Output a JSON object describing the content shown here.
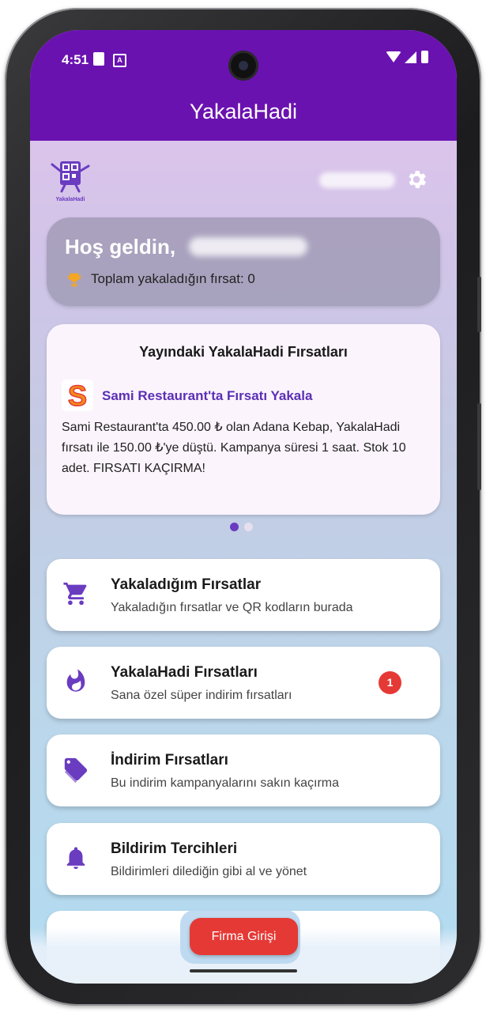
{
  "status_bar": {
    "time": "4:51",
    "keyboard_indicator": "A"
  },
  "app_bar": {
    "title": "YakalaHadi"
  },
  "header": {
    "logo_text": "YakalaHadi",
    "settings_icon": "gear-icon"
  },
  "welcome": {
    "greeting": "Hoş geldin,",
    "total_label": "Toplam yakaladığın fırsat: 0"
  },
  "promo": {
    "heading": "Yayındaki YakalaHadi Fırsatları",
    "title": "Sami Restaurant'ta Fırsatı Yakala",
    "body": "Sami Restaurant'ta 450.00 ₺ olan Adana Kebap, YakalaHadi fırsatı ile 150.00 ₺'ye düştü. Kampanya süresi 1 saat. Stok 10 adet. FIRSATI KAÇIRMA!",
    "logo_letter": "S",
    "active_page": 1,
    "page_count": 2
  },
  "menu": {
    "items": [
      {
        "title": "Yakaladığım Fırsatlar",
        "subtitle": "Yakaladığın fırsatlar ve QR kodların burada",
        "icon": "cart-icon"
      },
      {
        "title": "YakalaHadi Fırsatları",
        "subtitle": "Sana özel süper indirim fırsatları",
        "icon": "flame-icon",
        "badge": "1"
      },
      {
        "title": "İndirim Fırsatları",
        "subtitle": "Bu indirim kampanyalarını sakın kaçırma",
        "icon": "tag-icon"
      },
      {
        "title": "Bildirim Tercihleri",
        "subtitle": "Bildirimleri dilediğin gibi al ve yönet",
        "icon": "bell-icon"
      }
    ]
  },
  "footer": {
    "firma_button": "Firma Girişi"
  },
  "colors": {
    "primary": "#6a12b0",
    "accent_purple": "#5b2fb5",
    "icon_purple": "#6a3cc0",
    "danger": "#e53935",
    "trophy": "#f5a623"
  }
}
